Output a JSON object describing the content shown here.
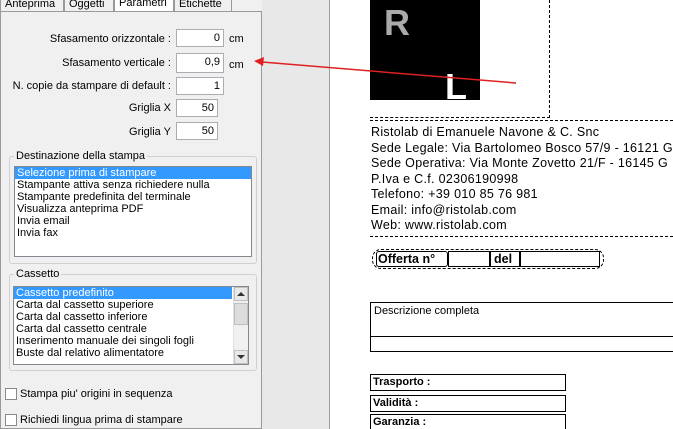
{
  "tabs": [
    "Anteprima",
    "Oggetti",
    "Parametri",
    "Etichette"
  ],
  "active_tab": "Parametri",
  "fields": {
    "h_offset": {
      "label": "Sfasamento orizzontale :",
      "value": "0",
      "unit": "cm"
    },
    "v_offset": {
      "label": "Sfasamento verticale :",
      "value": "0,9",
      "unit": "cm"
    },
    "copies": {
      "label": "N. copie da stampare di default :",
      "value": "1"
    },
    "grid_x": {
      "label": "Griglia X",
      "value": "50"
    },
    "grid_y": {
      "label": "Griglia Y",
      "value": "50"
    }
  },
  "destination": {
    "title": "Destinazione della stampa",
    "items": [
      "Selezione prima di stampare",
      "Stampante attiva senza richiedere nulla",
      "Stampante predefinita del terminale",
      "Visualizza anteprima PDF",
      "Invia email",
      "Invia fax"
    ],
    "selected": 0
  },
  "tray": {
    "title": "Cassetto",
    "items": [
      "Cassetto predefinito",
      "Carta dal cassetto superiore",
      "Carta dal cassetto inferiore",
      "Carta dal cassetto centrale",
      "Inserimento manuale dei singoli fogli",
      "Buste dal relativo alimentatore"
    ],
    "selected": 0
  },
  "checkboxes": {
    "multi_origins": {
      "label": "Stampa piu' origini in sequenza",
      "checked": false
    },
    "ask_language": {
      "label": "Richiedi lingua prima di stampare",
      "checked": false
    }
  },
  "document": {
    "logo_letters": [
      "R",
      "L"
    ],
    "company_lines": [
      "Ristolab di Emanuele Navone & C. Snc",
      "Sede Legale: Via Bartolomeo Bosco 57/9 - 16121 G",
      "Sede Operativa: Via Monte Zovetto 21/F - 16145 G",
      "P.Iva e C.f. 02306190998",
      "Telefono: +39 010 85 76 981",
      "Email: info@ristolab.com",
      "Web: www.ristolab.com"
    ],
    "offer_label": "Offerta n°",
    "offer_del": "del",
    "description_label": "Descrizione completa",
    "transport_label": "Trasporto :",
    "validity_label": "Validità :",
    "warranty_label": "Garanzia :"
  },
  "colors": {
    "selection": "#3399ff",
    "arrow": "#e02020"
  }
}
